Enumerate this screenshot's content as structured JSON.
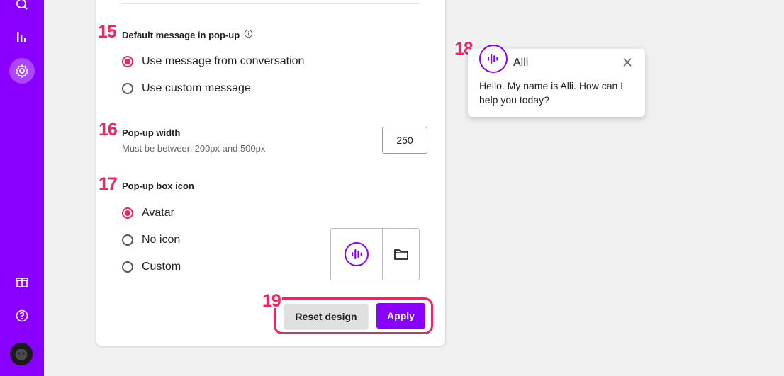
{
  "steps": [
    "15",
    "16",
    "17",
    "18",
    "19"
  ],
  "default_message": {
    "title": "Default message in pop-up",
    "options": [
      "Use message from conversation",
      "Use custom message"
    ],
    "selected": 0
  },
  "popup_width": {
    "title": "Pop-up width",
    "subtitle": "Must be between 200px and 500px",
    "value": "250"
  },
  "popup_icon": {
    "title": "Pop-up box icon",
    "options": [
      "Avatar",
      "No icon",
      "Custom"
    ],
    "selected": 0
  },
  "actions": {
    "reset_label": "Reset design",
    "apply_label": "Apply"
  },
  "preview": {
    "name": "Alli",
    "message": "Hello. My name is Alli. How can I help you today?"
  },
  "colors": {
    "brand": "#8a00ff",
    "accent": "#f0245f"
  },
  "icons": [
    "search-icon",
    "bar-chart-icon",
    "settings-icon",
    "gift-icon",
    "help-icon",
    "info-icon",
    "folder-icon",
    "close-icon",
    "alli-logo-icon"
  ]
}
